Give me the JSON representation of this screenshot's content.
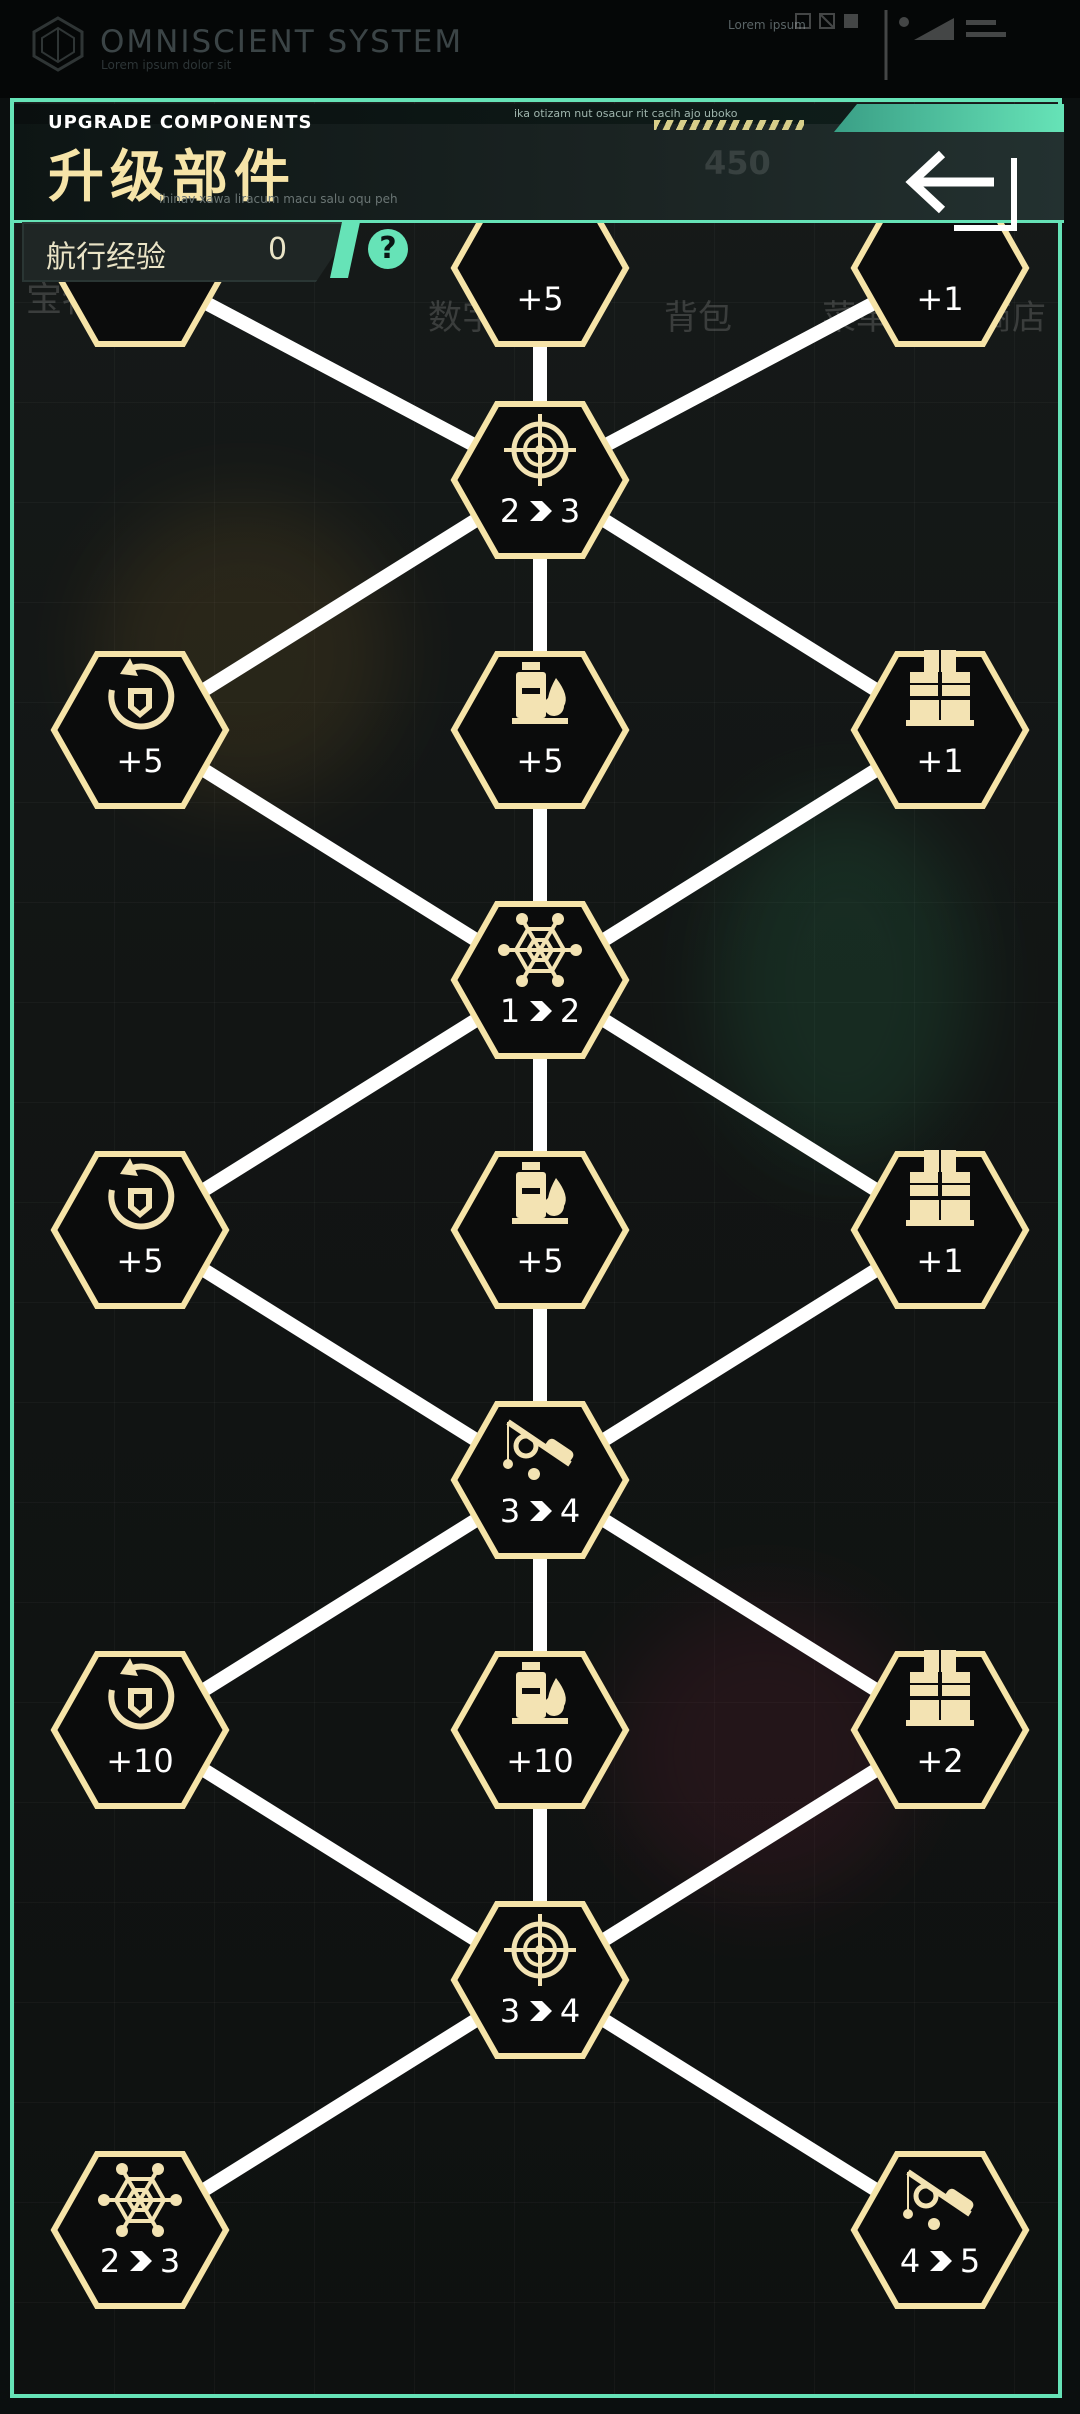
{
  "system": {
    "title": "OMNISCIENT  SYSTEM",
    "subtitle": "Lorem ipsum dolor sit",
    "lorem": "Lorem ipsum"
  },
  "header": {
    "title_en": "UPGRADE COMPONENTS",
    "title_cn": "升级部件",
    "tagline": "ihinav xawa liracum macu salu oqu peh",
    "top_note": "ika otizam nut osacur rit cacih ajo uboko",
    "faint_value": "450"
  },
  "experience": {
    "label": "航行经验",
    "value": "0"
  },
  "background_labels": [
    "数字空间",
    "背包",
    "菜单",
    "商店",
    "宝物商堂"
  ],
  "nodes": [
    {
      "id": "t0",
      "icon": "unknown-icon",
      "label": ""
    },
    {
      "id": "t1",
      "icon": "unknown-icon",
      "label": "+5"
    },
    {
      "id": "t2",
      "icon": "unknown-icon",
      "label": "+1"
    },
    {
      "id": "n1",
      "icon": "target-icon",
      "label_from": "2",
      "label_to": "3"
    },
    {
      "id": "n2",
      "icon": "shield-refresh-icon",
      "label": "+5"
    },
    {
      "id": "n3",
      "icon": "fuel-can-icon",
      "label": "+5"
    },
    {
      "id": "n4",
      "icon": "crates-icon",
      "label": "+1"
    },
    {
      "id": "n5",
      "icon": "web-icon",
      "label_from": "1",
      "label_to": "2"
    },
    {
      "id": "n6",
      "icon": "shield-refresh-icon",
      "label": "+5"
    },
    {
      "id": "n7",
      "icon": "fuel-can-icon",
      "label": "+5"
    },
    {
      "id": "n8",
      "icon": "crates-icon",
      "label": "+1"
    },
    {
      "id": "n9",
      "icon": "fishing-rod-icon",
      "label_from": "3",
      "label_to": "4"
    },
    {
      "id": "n10",
      "icon": "shield-refresh-icon",
      "label": "+10"
    },
    {
      "id": "n11",
      "icon": "fuel-can-icon",
      "label": "+10"
    },
    {
      "id": "n12",
      "icon": "crates-icon",
      "label": "+2"
    },
    {
      "id": "n13",
      "icon": "target-icon",
      "label_from": "3",
      "label_to": "4"
    },
    {
      "id": "n14",
      "icon": "web-icon",
      "label_from": "2",
      "label_to": "3"
    },
    {
      "id": "n15",
      "icon": "fishing-rod-icon",
      "label_from": "4",
      "label_to": "5"
    }
  ],
  "colors": {
    "accent": "#66e3b7",
    "node_border": "#f6e4a8",
    "node_fill": "#0b0c0c",
    "icon": "#f3e3b3",
    "line": "#ffffff"
  }
}
